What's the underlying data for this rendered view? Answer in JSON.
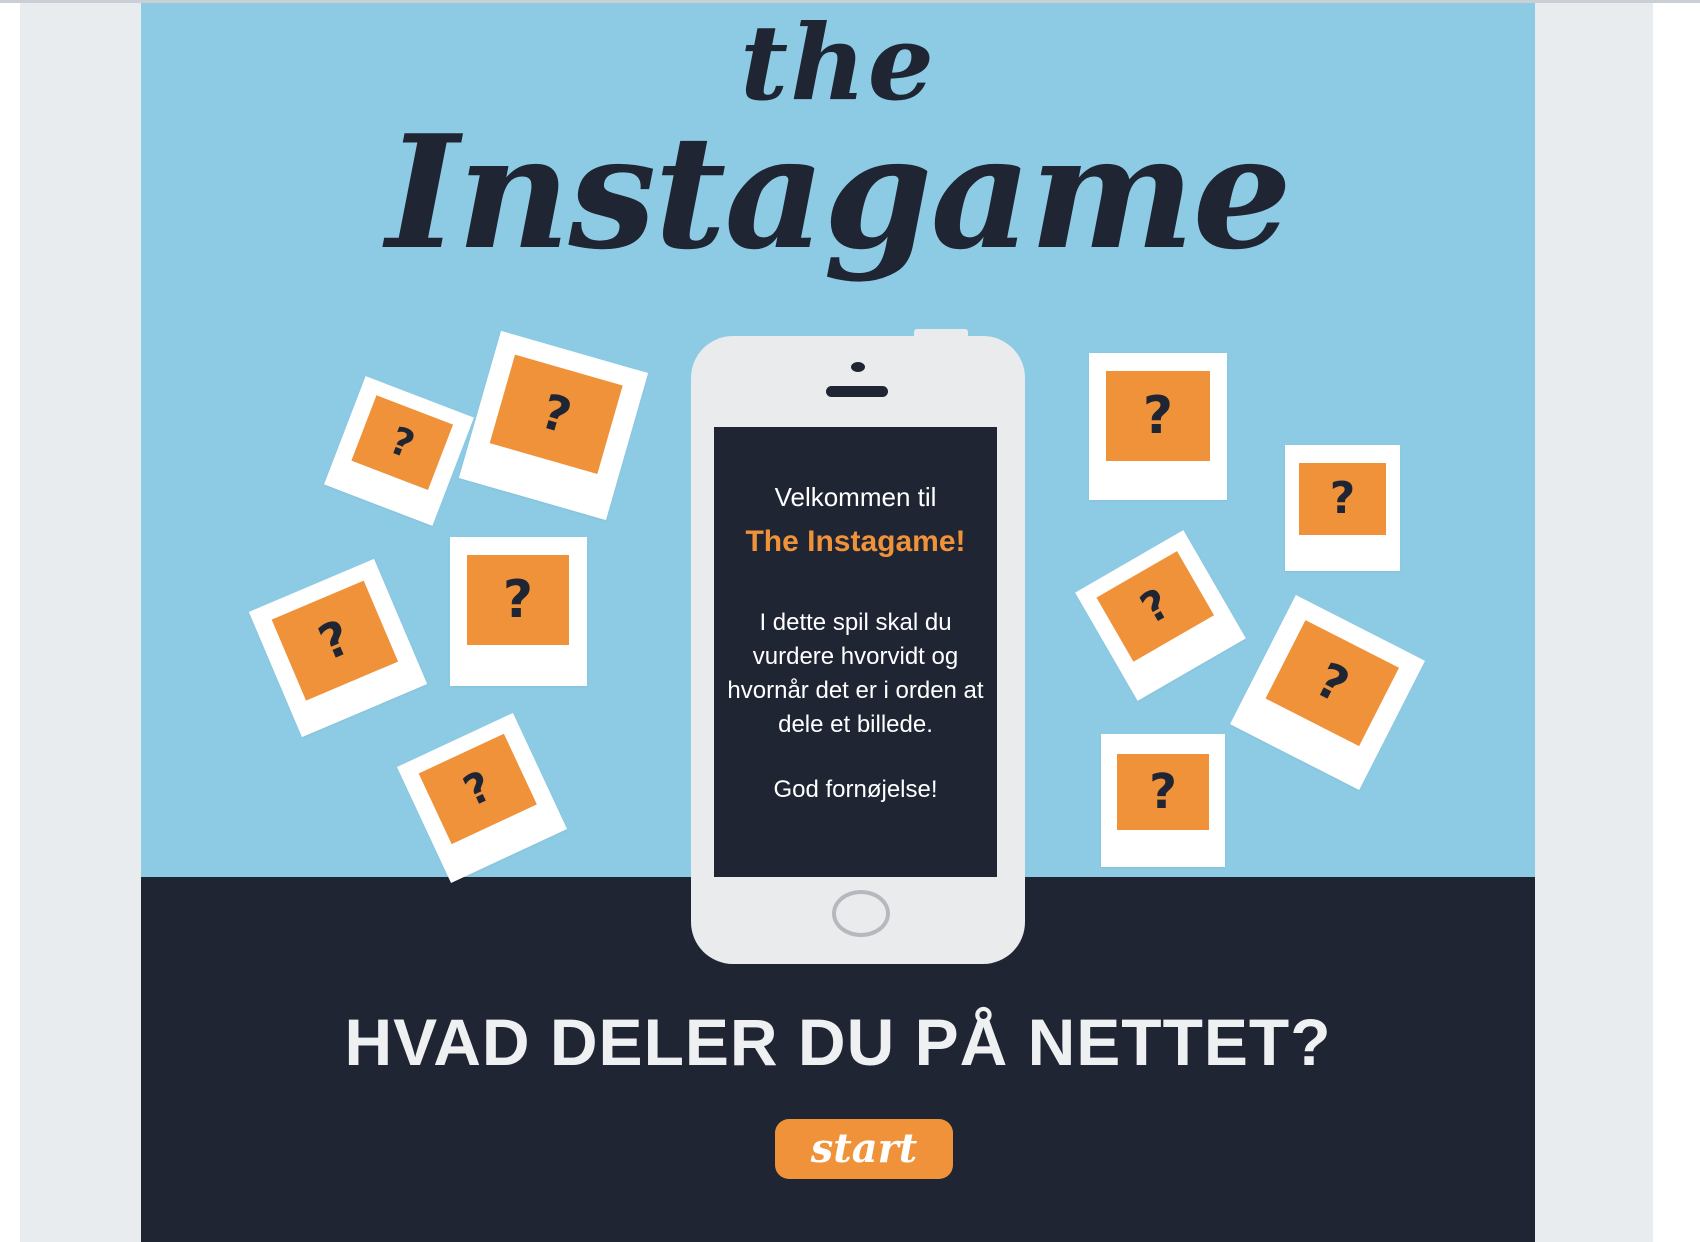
{
  "logo": {
    "the": "the",
    "main": "Instagame"
  },
  "phone_screen": {
    "welcome": "Velkommen til",
    "game_name": "The Instagame!",
    "intro": "I dette spil skal du vurdere hvorvidt og hvornår det er i orden at dele et billede.",
    "goodbye": "God fornøjelse!"
  },
  "polaroid_mark": "?",
  "headline": "HVAD DELER DU PÅ NETTET?",
  "start_button": "start",
  "colors": {
    "sky": "#8dcbe5",
    "ground": "#1f2533",
    "accent_orange": "#f0923a",
    "phone_body": "#e9ebed",
    "gutter": "#e8ecee"
  }
}
